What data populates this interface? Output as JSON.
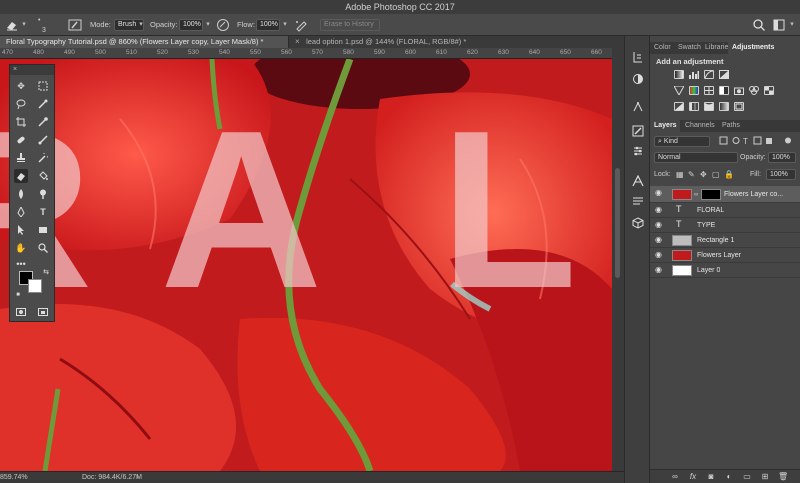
{
  "app": {
    "title": "Adobe Photoshop CC 2017"
  },
  "options": {
    "brush_size": "3",
    "mode_label": "Mode:",
    "mode_value": "Brush",
    "opacity_label": "Opacity:",
    "opacity_value": "100%",
    "flow_label": "Flow:",
    "flow_value": "100%",
    "erase_history_label": "Erase to History"
  },
  "tabs": [
    {
      "label": "Floral Typography Tutorial.psd @ 860% (Flowers Layer copy, Layer Mask/8) *",
      "active": true
    },
    {
      "label": "lead option 1.psd @ 144% (FLORAL, RGB/8#) *",
      "active": false
    }
  ],
  "ruler": {
    "ticks": [
      "470",
      "480",
      "490",
      "500",
      "510",
      "520",
      "530",
      "540",
      "550",
      "560",
      "570",
      "580",
      "590",
      "600",
      "610",
      "620",
      "630",
      "640",
      "650",
      "660"
    ]
  },
  "canvas": {
    "letters": [
      "R",
      "A",
      "L"
    ]
  },
  "status": {
    "zoom": "859.74%",
    "doc": "Doc: 984.4K/6.27M"
  },
  "tools_panel": {
    "close_glyph": "×"
  },
  "panels": {
    "top_tabs": [
      "Color",
      "Swatch",
      "Librarie",
      "Adjustments"
    ],
    "adjustments_title": "Add an adjustment",
    "layer_tabs": [
      "Layers",
      "Channels",
      "Paths"
    ],
    "filter_value": "Kind",
    "blend_mode": "Normal",
    "opacity_label": "Opacity:",
    "opacity_value": "100%",
    "lock_label": "Lock:",
    "fill_label": "Fill:",
    "fill_value": "100%"
  },
  "layers": [
    {
      "name": "Flowers Layer co...",
      "kind": "image-mask",
      "selected": true
    },
    {
      "name": "FLORAL",
      "kind": "text",
      "selected": false
    },
    {
      "name": "TYPE",
      "kind": "text",
      "selected": false
    },
    {
      "name": "Rectangle 1",
      "kind": "shape",
      "selected": false
    },
    {
      "name": "Flowers Layer",
      "kind": "image",
      "selected": false
    },
    {
      "name": "Layer 0",
      "kind": "white",
      "selected": false
    }
  ],
  "layer_footer": {
    "fx_label": "fx"
  },
  "colors": {
    "app_bg": "#323232",
    "panel_bg": "#464646",
    "poppy_red": "#c01a1c",
    "stem_green": "#6f9a3a",
    "letter_tint": "#f3c6c8"
  }
}
